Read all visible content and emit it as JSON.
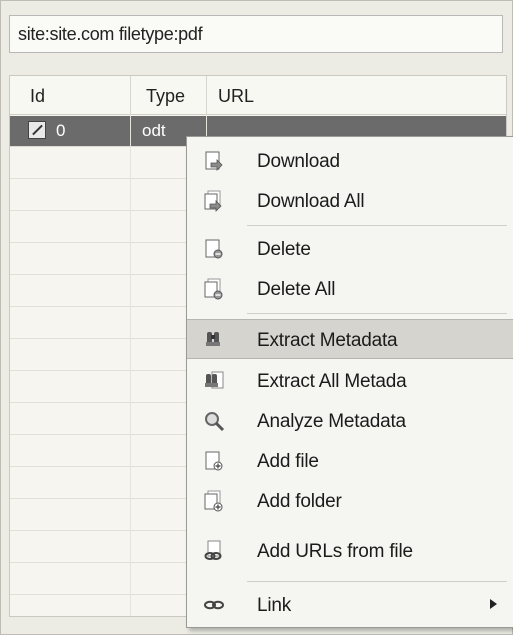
{
  "search": {
    "value": "site:site.com filetype:pdf"
  },
  "table": {
    "columns": [
      "Id",
      "Type",
      "URL"
    ],
    "rows": [
      {
        "id": "0",
        "type": "odt"
      }
    ]
  },
  "context_menu": {
    "items": [
      {
        "label": "Download",
        "icon": "download-icon"
      },
      {
        "label": "Download All",
        "icon": "download-all-icon"
      },
      {
        "label": "Delete",
        "icon": "delete-icon"
      },
      {
        "label": "Delete All",
        "icon": "delete-all-icon"
      },
      {
        "label": "Extract Metadata",
        "icon": "extract-metadata-icon",
        "highlighted": true
      },
      {
        "label": "Extract All Metada",
        "icon": "extract-all-metadata-icon"
      },
      {
        "label": "Analyze Metadata",
        "icon": "magnifier-icon"
      },
      {
        "label": "Add file",
        "icon": "add-file-icon"
      },
      {
        "label": "Add folder",
        "icon": "add-folder-icon"
      },
      {
        "label": "Add URLs from file",
        "icon": "link-file-icon"
      },
      {
        "label": "Link",
        "icon": "link-icon",
        "submenu": true
      }
    ]
  },
  "colors": {
    "selected_row": "#6b6b6b",
    "menu_highlight": "#d6d4ce"
  }
}
